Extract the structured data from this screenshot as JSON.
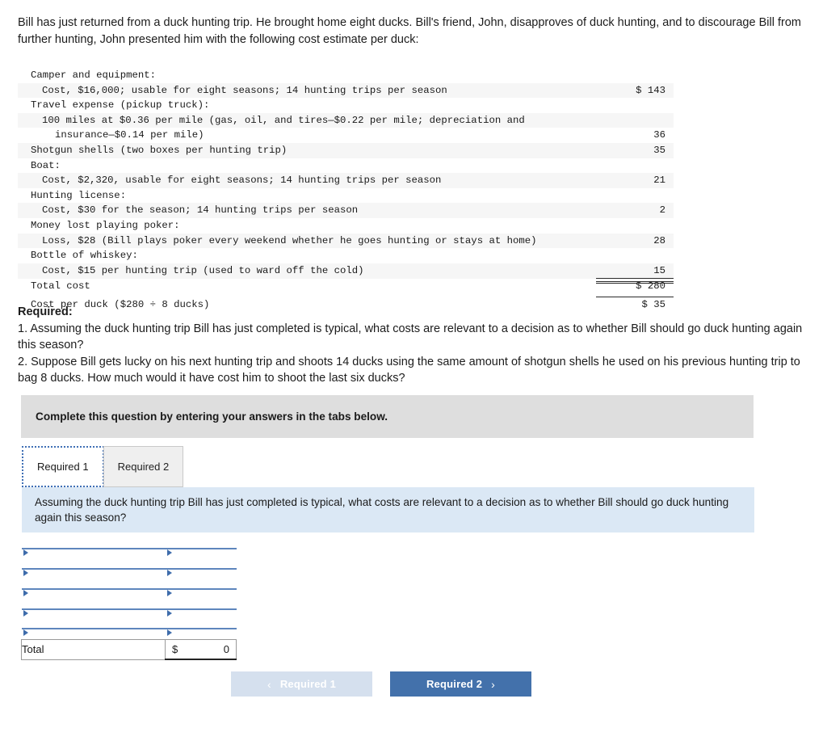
{
  "intro": "Bill has just returned from a duck hunting trip. He brought home eight ducks. Bill's friend, John, disapproves of duck hunting, and to discourage Bill from further hunting, John presented him with the following cost estimate per duck:",
  "cost_estimate": {
    "rows": [
      {
        "label": "Camper and equipment:",
        "indent": 0,
        "value": ""
      },
      {
        "label": "Cost, $16,000; usable for eight seasons; 14 hunting trips per season",
        "indent": 1,
        "value": "$ 143"
      },
      {
        "label": "Travel expense (pickup truck):",
        "indent": 0,
        "value": ""
      },
      {
        "label": "100 miles at $0.36 per mile (gas, oil, and tires—$0.22 per mile; depreciation and",
        "indent": 1,
        "value": ""
      },
      {
        "label": "insurance—$0.14 per mile)",
        "indent": 2,
        "value": "36"
      },
      {
        "label": "Shotgun shells (two boxes per hunting trip)",
        "indent": 0,
        "value": "35"
      },
      {
        "label": "Boat:",
        "indent": 0,
        "value": ""
      },
      {
        "label": "Cost, $2,320, usable for eight seasons; 14 hunting trips per season",
        "indent": 1,
        "value": "21"
      },
      {
        "label": "Hunting license:",
        "indent": 0,
        "value": ""
      },
      {
        "label": "Cost, $30 for the season; 14 hunting trips per season",
        "indent": 1,
        "value": "2"
      },
      {
        "label": "Money lost playing poker:",
        "indent": 0,
        "value": ""
      },
      {
        "label": "Loss, $28 (Bill plays poker every weekend whether he goes hunting or stays at home)",
        "indent": 1,
        "value": "28"
      },
      {
        "label": "Bottle of whiskey:",
        "indent": 0,
        "value": ""
      },
      {
        "label": "Cost, $15 per hunting trip (used to ward off the cold)",
        "indent": 1,
        "value": "15"
      }
    ],
    "total_label": "Total cost",
    "total_value": "$ 280",
    "per_duck_label": "Cost per duck ($280 ÷ 8 ducks)",
    "per_duck_value": "$ 35"
  },
  "required": {
    "heading": "Required:",
    "item1": "1.  Assuming the duck hunting trip Bill has just completed is typical, what costs are relevant to a decision as to whether Bill should go duck hunting again this season?",
    "item2": "2. Suppose Bill gets lucky on his next hunting trip and shoots 14 ducks using the same amount of shotgun shells he used on his previous hunting trip to bag 8 ducks. How much would it have cost him to shoot the last six ducks?"
  },
  "instruction_bar": {
    "text": "Complete this question by entering your answers in the tabs below."
  },
  "tabs": [
    {
      "label": "Required 1",
      "active": true
    },
    {
      "label": "Required 2",
      "active": false
    }
  ],
  "question_panel": {
    "text": "Assuming the duck hunting trip Bill has just completed is typical, what costs are relevant to a decision as to whether Bill should go duck hunting again this season?"
  },
  "answer_table": {
    "input_rows": [
      {
        "description": "",
        "amount": ""
      },
      {
        "description": "",
        "amount": ""
      },
      {
        "description": "",
        "amount": ""
      },
      {
        "description": "",
        "amount": ""
      },
      {
        "description": "",
        "amount": ""
      }
    ],
    "total_label": "Total",
    "total_currency": "$",
    "total_value": "0"
  },
  "nav": {
    "prev_label": "Required 1",
    "prev_chevron": "‹",
    "next_label": "Required 2",
    "next_chevron": "›"
  },
  "colors": {
    "accent_blue": "#4371ab",
    "panel_blue": "#dbe8f5",
    "instruction_gray": "#dedede",
    "input_border_blue": "#5e86bd",
    "disabled_button": "#d5e0ee"
  }
}
